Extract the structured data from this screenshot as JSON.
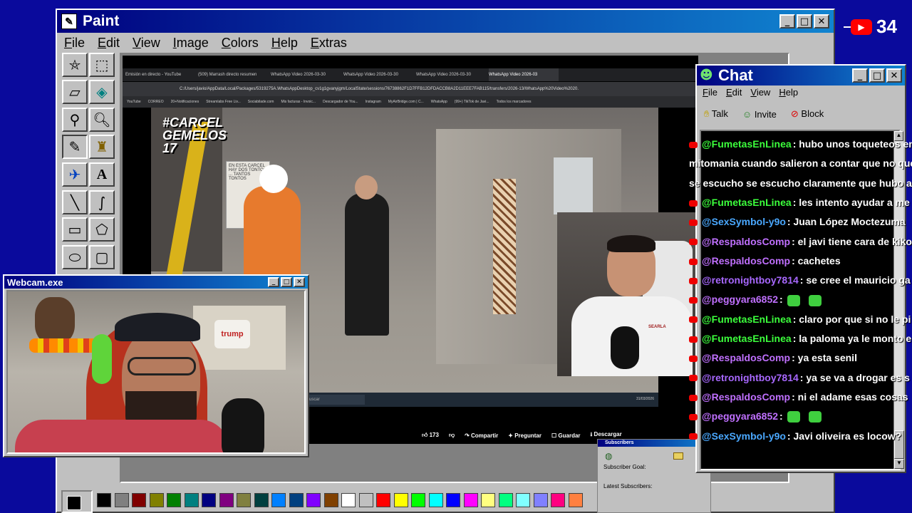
{
  "paint": {
    "title": "Paint",
    "menu": [
      "File",
      "Edit",
      "View",
      "Image",
      "Colors",
      "Help",
      "Extras"
    ],
    "palette": [
      "#000000",
      "#808080",
      "#800000",
      "#808000",
      "#008000",
      "#008080",
      "#000080",
      "#800080",
      "#808040",
      "#004040",
      "#0080ff",
      "#004080",
      "#8000ff",
      "#804000",
      "#ffffff",
      "#c0c0c0",
      "#ff0000",
      "#ffff00",
      "#00ff00",
      "#00ffff",
      "#0000ff",
      "#ff00ff",
      "#ffff80",
      "#00ff80",
      "#80ffff",
      "#8080ff",
      "#ff0080",
      "#ff8040"
    ]
  },
  "badge": {
    "count": "34"
  },
  "browser": {
    "tabs": [
      "Emisión en directo - YouTube",
      "(509) Marrash directo resumen",
      "WhatsApp Video 2026-03-30",
      "WhatsApp Video 2026-03-30",
      "WhatsApp Video 2026-03-30",
      "WhatsApp Video 2026-03"
    ],
    "address": "C:/Users/javio/AppData/Local/Packages/5319275A.WhatsAppDesktop_cv1g1gvanyjgm/LocalState/sessions/76738862F1D7FFB12DFDACCB8A2D11EEE7FAB115/transfers/2026-13/WhatsApp%20Video%2020...",
    "bookmarks": [
      "YouTube",
      "CORREO",
      "20+Notificaciones",
      "Streamlabs Free Liv...",
      "Sociabilade.com",
      "Mis facturas - Invoic...",
      "Descargador de You...",
      "Instagram",
      "MyAirBridge.com | C...",
      "WhatsApp",
      "(99+) TikTok de Javi...",
      "Todos los marcadores"
    ],
    "overlay_tag": "#CARCEL GEMELOS 17",
    "whiteboard": "EN ESTA CARCEL HAY DOS TONTOS ... TANTOS TONTOS",
    "shirt": "SEARLA",
    "time": "31/03/2026",
    "taskbar_search": "uscar",
    "actions": {
      "likes": "173",
      "share": "Compartir",
      "ask": "Preguntar",
      "save": "Guardar",
      "download": "Descargar"
    }
  },
  "webcam": {
    "title": "Webcam.exe",
    "jar_label": "trump"
  },
  "chat": {
    "title": "Chat",
    "menu": [
      "File",
      "Edit",
      "View",
      "Help"
    ],
    "toolbar": {
      "talk": "Talk",
      "invite": "Invite",
      "block": "Block"
    },
    "messages": [
      {
        "user": "@FumetasEnLinea",
        "text": ": hubo unos toqueteos en",
        "color": "#3cff3c"
      },
      {
        "user": "",
        "text": "mitomania cuando salieron a contar que no que",
        "color": "#3cff3c"
      },
      {
        "user": "",
        "text": "se escucho se escucho claramente que hubo alg",
        "color": "#3cff3c"
      },
      {
        "user": "@FumetasEnLinea",
        "text": ": les intento ayudar a me",
        "color": "#3cff3c"
      },
      {
        "user": "@SexSymbol-y9o",
        "text": ": Juan López Moctezuma",
        "color": "#4aa8ff"
      },
      {
        "user": "@RespaldosComp",
        "text": ": el javi tiene cara de kiko",
        "color": "#c070ff"
      },
      {
        "user": "@RespaldosComp",
        "text": ": cachetes",
        "color": "#c070ff"
      },
      {
        "user": "@retronightboy7814",
        "text": ": se cree el mauricio ga",
        "color": "#a868ff"
      },
      {
        "user": "@peggyara6852",
        "text": ":",
        "color": "#c070ff",
        "emotes": 2
      },
      {
        "user": "@FumetasEnLinea",
        "text": ": claro por que si no le pi",
        "color": "#3cff3c"
      },
      {
        "user": "@FumetasEnLinea",
        "text": ": la paloma ya le monto e",
        "color": "#3cff3c"
      },
      {
        "user": "@RespaldosComp",
        "text": ": ya esta senil",
        "color": "#c070ff"
      },
      {
        "user": "@retronightboy7814",
        "text": ": ya se va a drogar es s",
        "color": "#a868ff"
      },
      {
        "user": "@RespaldosComp",
        "text": ": ni el adame esas cosas",
        "color": "#c070ff"
      },
      {
        "user": "@peggyara6852",
        "text": ":",
        "color": "#c070ff",
        "emotes": 2
      },
      {
        "user": "@SexSymbol-y9o",
        "text": ": Javi oliveira es locow?",
        "color": "#4aa8ff"
      }
    ]
  },
  "subscribers": {
    "title": "Subscribers",
    "goal": "Subscriber Goal:",
    "latest": "Latest Subscribers:"
  }
}
